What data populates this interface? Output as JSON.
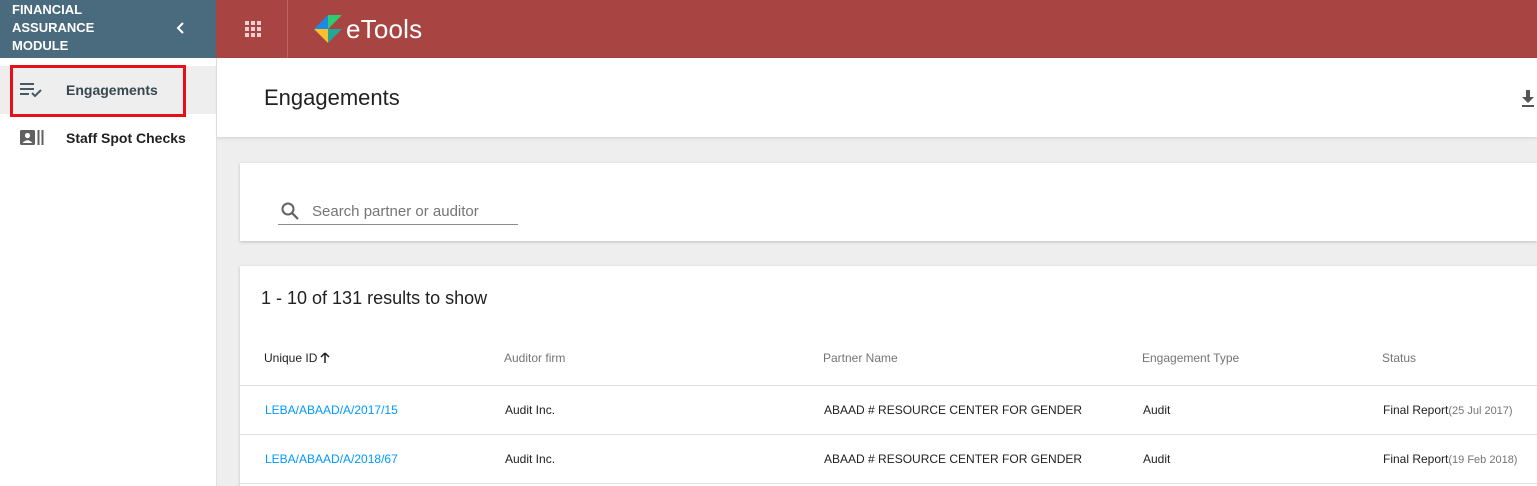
{
  "sidebar": {
    "module_title": "FINANCIAL ASSURANCE MODULE",
    "items": [
      {
        "label": "Engagements",
        "icon": "playlist-check-icon",
        "active": true
      },
      {
        "label": "Staff Spot Checks",
        "icon": "contact-card-icon",
        "active": false
      }
    ]
  },
  "topbar": {
    "app_name": "eTools"
  },
  "page": {
    "title": "Engagements"
  },
  "search": {
    "placeholder": "Search partner or auditor",
    "value": ""
  },
  "results": {
    "count_text": "1 - 10 of 131 results to show",
    "columns": [
      "Unique ID",
      "Auditor firm",
      "Partner Name",
      "Engagement Type",
      "Status"
    ],
    "rows": [
      {
        "unique_id": "LEBA/ABAAD/A/2017/15",
        "auditor_firm": "Audit Inc.",
        "partner_name": "ABAAD # RESOURCE CENTER FOR GENDER",
        "engagement_type": "Audit",
        "status": "Final Report",
        "status_date": "(25 Jul 2017)"
      },
      {
        "unique_id": "LEBA/ABAAD/A/2018/67",
        "auditor_firm": "Audit Inc.",
        "partner_name": "ABAAD # RESOURCE CENTER FOR GENDER",
        "engagement_type": "Audit",
        "status": "Final Report",
        "status_date": "(19 Feb 2018)"
      }
    ]
  },
  "colors": {
    "topbar": "#a84543",
    "sidebar_header": "#4a6a7d",
    "link": "#0099ff",
    "highlight": "#e5101a"
  }
}
